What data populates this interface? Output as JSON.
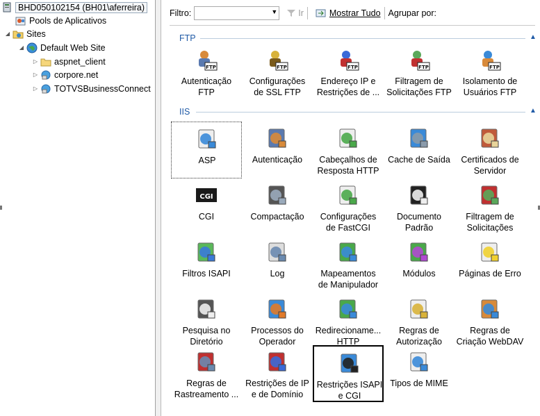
{
  "tree": {
    "items": [
      {
        "label": "BHD050102154 (BH01\\aferreira)",
        "icon": "server-icon"
      },
      {
        "label": "Pools de Aplicativos",
        "icon": "app-pools-icon"
      },
      {
        "label": "Sites",
        "icon": "sites-folder-icon"
      },
      {
        "label": "Default Web Site",
        "icon": "globe-icon"
      },
      {
        "label": "aspnet_client",
        "icon": "folder-icon"
      },
      {
        "label": "corpore.net",
        "icon": "web-app-icon"
      },
      {
        "label": "TOTVSBusinessConnect",
        "icon": "web-app-icon"
      }
    ]
  },
  "filterbar": {
    "filter_label": "Filtro:",
    "go_label": "Ir",
    "show_all_label": "Mostrar Tudo",
    "group_by_label": "Agrupar por:"
  },
  "groups": {
    "ftp": {
      "title": "FTP"
    },
    "iis": {
      "title": "IIS"
    }
  },
  "ftp_tiles": [
    {
      "label": "Autenticação\nFTP",
      "icon": "ftp-authentication-icon"
    },
    {
      "label": "Configurações\nde SSL FTP",
      "icon": "ftp-ssl-lock-icon"
    },
    {
      "label": "Endereço IP e\nRestrições de ...",
      "icon": "ftp-ip-restrictions-icon"
    },
    {
      "label": "Filtragem de\nSolicitações FTP",
      "icon": "ftp-request-filtering-icon"
    },
    {
      "label": "Isolamento de\nUsuários FTP",
      "icon": "ftp-user-isolation-icon"
    }
  ],
  "iis_tiles": [
    {
      "label": "ASP",
      "icon": "asp-icon"
    },
    {
      "label": "Autenticação",
      "icon": "authentication-icon"
    },
    {
      "label": "Cabeçalhos de\nResposta HTTP",
      "icon": "http-headers-icon"
    },
    {
      "label": "Cache de Saída",
      "icon": "output-cache-icon"
    },
    {
      "label": "Certificados de\nServidor",
      "icon": "server-certificates-icon"
    },
    {
      "label": "CGI",
      "icon": "cgi-icon"
    },
    {
      "label": "Compactação",
      "icon": "compression-icon"
    },
    {
      "label": "Configurações\nde FastCGI",
      "icon": "fastcgi-icon"
    },
    {
      "label": "Documento\nPadrão",
      "icon": "default-document-icon"
    },
    {
      "label": "Filtragem de\nSolicitações",
      "icon": "request-filtering-icon"
    },
    {
      "label": "Filtros ISAPI",
      "icon": "isapi-filters-icon"
    },
    {
      "label": "Log",
      "icon": "log-icon"
    },
    {
      "label": "Mapeamentos\nde Manipulador",
      "icon": "handler-mappings-icon"
    },
    {
      "label": "Módulos",
      "icon": "modules-icon"
    },
    {
      "label": "Páginas de Erro",
      "icon": "error-pages-icon"
    },
    {
      "label": "Pesquisa no\nDiretório",
      "icon": "directory-browsing-icon"
    },
    {
      "label": "Processos do\nOperador",
      "icon": "worker-processes-icon"
    },
    {
      "label": "Redireciona­me...\nHTTP",
      "icon": "http-redirect-icon"
    },
    {
      "label": "Regras de\nAutorização",
      "icon": "authorization-rules-icon"
    },
    {
      "label": "Regras de\nCriação WebDAV",
      "icon": "webdav-icon"
    },
    {
      "label": "Regras de\nRastreamento ...",
      "icon": "failed-request-tracing-icon"
    },
    {
      "label": "Restrições de IP\ne de Domínio",
      "icon": "ip-domain-restrictions-icon"
    },
    {
      "label": "Restrições ISAPI\ne CGI",
      "icon": "isapi-cgi-restrictions-icon"
    },
    {
      "label": "Tipos de MIME",
      "icon": "mime-types-icon"
    }
  ]
}
